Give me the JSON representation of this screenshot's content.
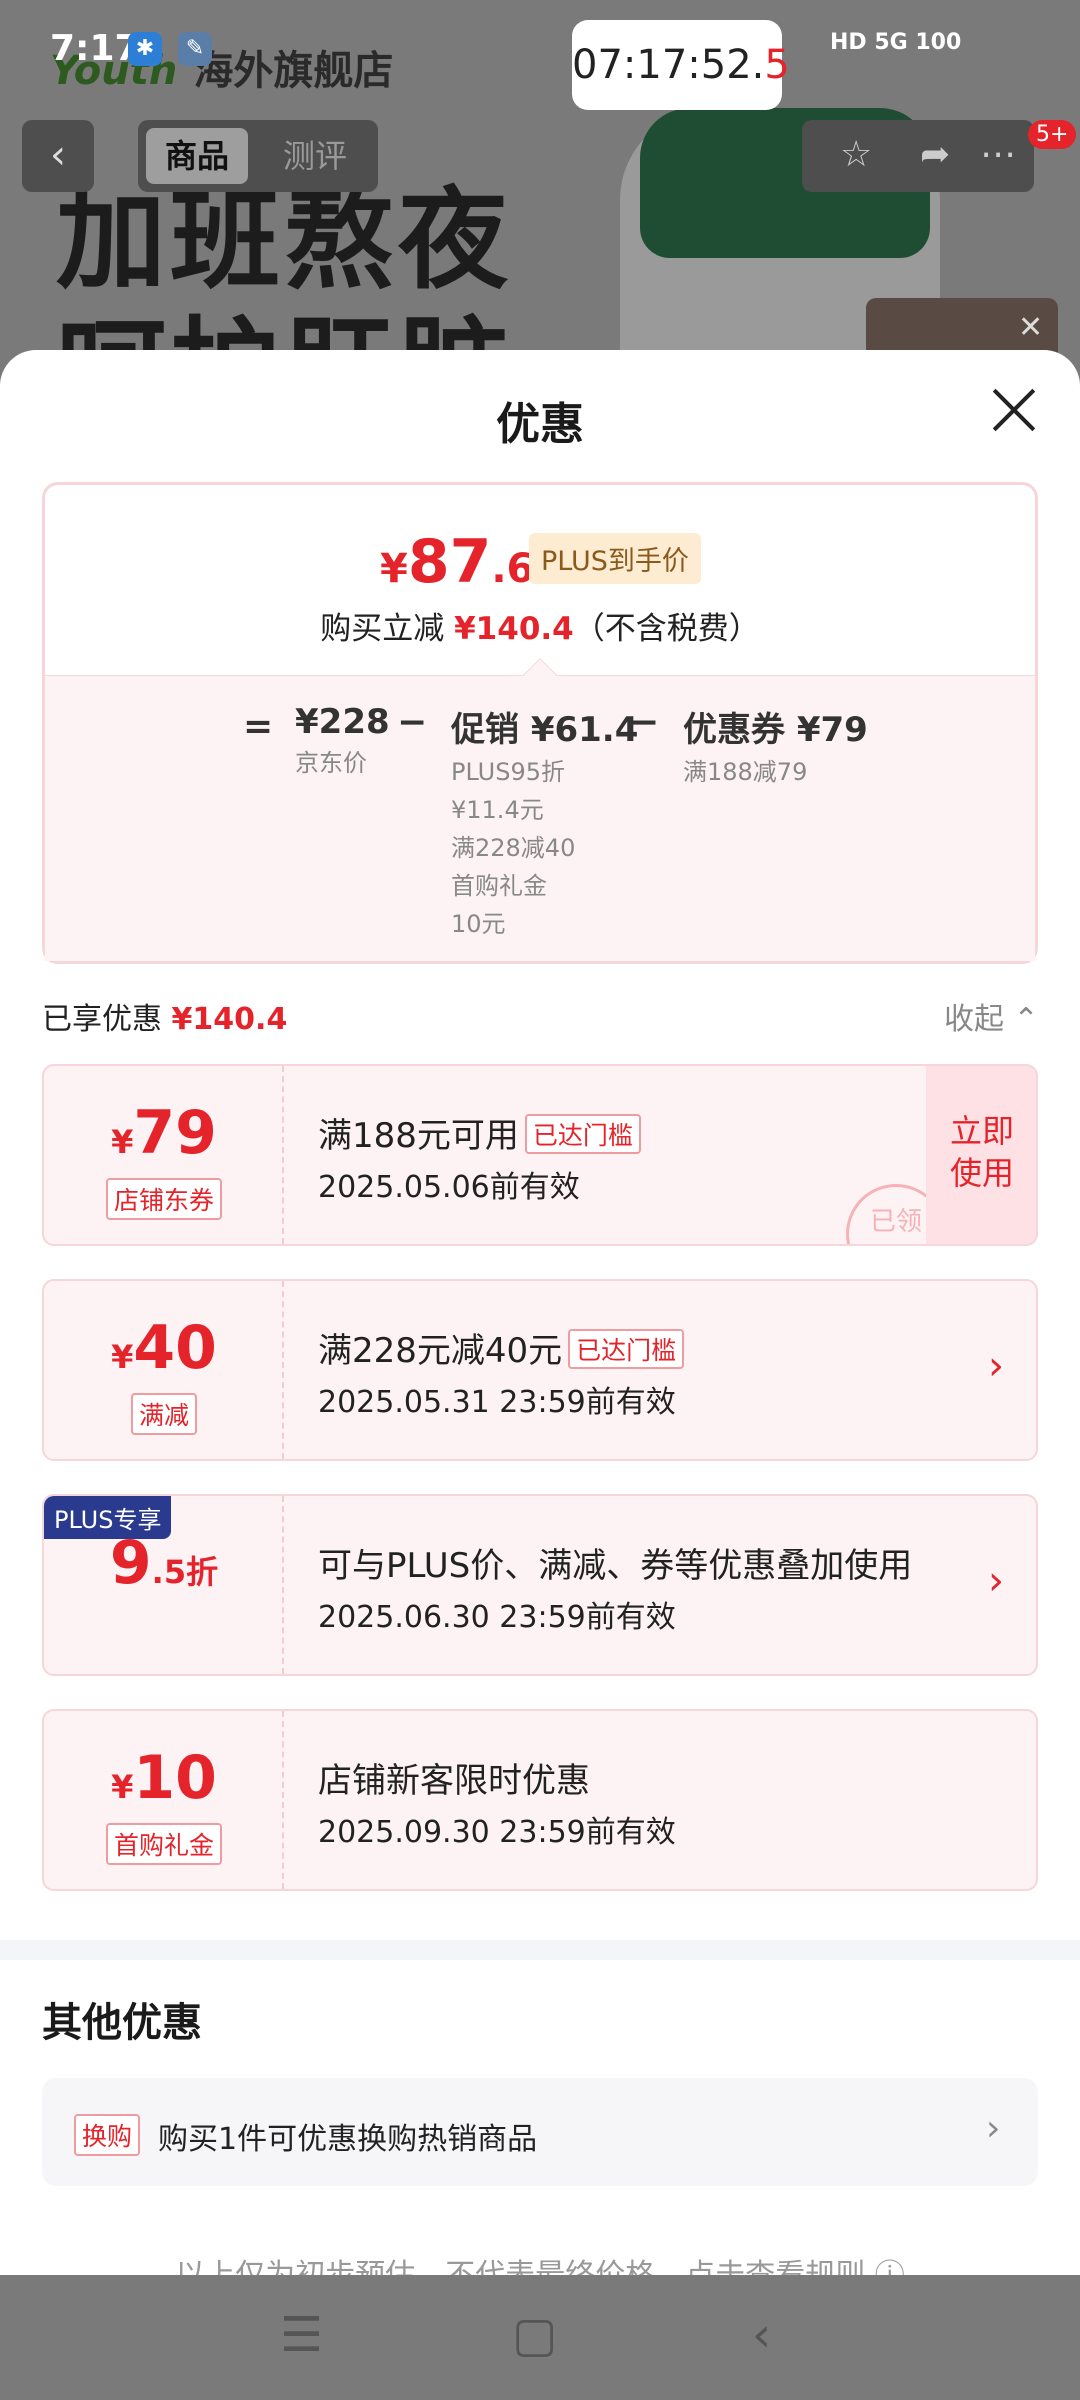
{
  "status": {
    "time": "7:17",
    "clock_main": "07:17:52.",
    "clock_last": "5",
    "signals": "HD 5G 100"
  },
  "background": {
    "brand": "海外旗舰店",
    "brand_logo": "Youth",
    "headline1": "加班熬夜",
    "headline2": "呵护肝脏",
    "badge": "5+"
  },
  "nav": {
    "tab_product": "商品",
    "tab_review": "测评"
  },
  "sheet": {
    "title": "优惠",
    "price": {
      "currency": "¥",
      "int": "87",
      "dec": ".6",
      "tag": "PLUS到手价",
      "buy_prefix": "购买立减",
      "buy_amount": "¥140.4",
      "buy_suffix": "（不含税费）"
    },
    "breakdown": {
      "eq": "=",
      "jd_price": "¥228",
      "jd_label": "京东价",
      "minus1": "−",
      "promo_title": "促销 ¥61.4",
      "promo_items": [
        "PLUS95折",
        "¥11.4元",
        "满228减40",
        "首购礼金",
        "10元"
      ],
      "minus2": "−",
      "coupon_title": "优惠券 ¥79",
      "coupon_sub": "满188减79"
    },
    "enjoyed_label": "已享优惠",
    "enjoyed_amount": "¥140.4",
    "collapse": "收起 ⌃",
    "coupons": [
      {
        "cur": "¥",
        "amount": "79",
        "tag": "店铺东券",
        "title": "满188元可用",
        "threshold": "已达门槛",
        "date": "2025.05.06前有效",
        "action1": "立即",
        "action2": "使用",
        "stamp": "已领"
      },
      {
        "cur": "¥",
        "amount": "40",
        "tag": "满减",
        "title": "满228元减40元",
        "threshold": "已达门槛",
        "date": "2025.05.31 23:59前有效",
        "arrow": "›"
      },
      {
        "plus": "PLUS专享",
        "amount": "9",
        "small": ".5折",
        "title": "可与PLUS价、满减、券等优惠叠加使用",
        "date": "2025.06.30 23:59前有效",
        "arrow": "›"
      },
      {
        "cur": "¥",
        "amount": "10",
        "tag": "首购礼金",
        "title": "店铺新客限时优惠",
        "date": "2025.09.30 23:59前有效"
      }
    ],
    "other_title": "其他优惠",
    "other_tag": "换购",
    "other_text": "购买1件可优惠换购热销商品",
    "other_arrow": "›",
    "disclaimer": "以上仅为初步预估，不代表最终价格，点击查看规则 ⓘ"
  }
}
